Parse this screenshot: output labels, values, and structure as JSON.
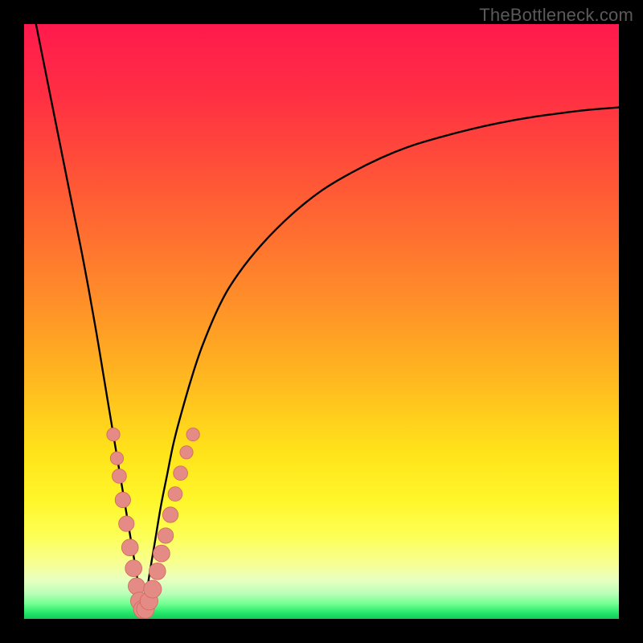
{
  "watermark": "TheBottleneck.com",
  "colors": {
    "frame": "#000000",
    "curve": "#000000",
    "marker_fill": "#e58b85",
    "marker_stroke": "#d46a63",
    "gradient_stops": [
      {
        "offset": 0.0,
        "color": "#ff1a4d"
      },
      {
        "offset": 0.12,
        "color": "#ff2f43"
      },
      {
        "offset": 0.28,
        "color": "#ff5a35"
      },
      {
        "offset": 0.45,
        "color": "#ff8a2a"
      },
      {
        "offset": 0.6,
        "color": "#ffb91f"
      },
      {
        "offset": 0.72,
        "color": "#ffe31a"
      },
      {
        "offset": 0.8,
        "color": "#fff62a"
      },
      {
        "offset": 0.86,
        "color": "#fdff55"
      },
      {
        "offset": 0.905,
        "color": "#f8ff90"
      },
      {
        "offset": 0.935,
        "color": "#e8ffc0"
      },
      {
        "offset": 0.958,
        "color": "#b8ffb8"
      },
      {
        "offset": 0.975,
        "color": "#70ff90"
      },
      {
        "offset": 0.99,
        "color": "#22e86a"
      },
      {
        "offset": 1.0,
        "color": "#16c95a"
      }
    ]
  },
  "chart_data": {
    "type": "line",
    "title": "",
    "xlabel": "",
    "ylabel": "",
    "xlim": [
      0,
      100
    ],
    "ylim": [
      0,
      100
    ],
    "note": "V-shaped bottleneck curve. y ≈ 0 (optimal) at x ≈ 20; y rises to ~100 at x→0 and asymptotically toward ~86 as x→100.",
    "series": [
      {
        "name": "bottleneck-curve",
        "x": [
          2,
          4,
          6,
          8,
          10,
          12,
          14,
          15,
          16,
          17,
          18,
          19,
          19.7,
          20.3,
          21,
          22,
          23,
          24,
          25,
          26,
          28,
          30,
          33,
          36,
          40,
          45,
          50,
          55,
          60,
          65,
          70,
          75,
          80,
          85,
          90,
          95,
          100
        ],
        "y": [
          100,
          90,
          80,
          70,
          60,
          49,
          37,
          31,
          25,
          19,
          13,
          7,
          2,
          2,
          7,
          13,
          19,
          24,
          29,
          33,
          40,
          46,
          53,
          58,
          63,
          68,
          72,
          75,
          77.5,
          79.5,
          81,
          82.3,
          83.4,
          84.3,
          85,
          85.6,
          86
        ]
      }
    ],
    "markers": {
      "name": "highlighted-points",
      "comment": "Salmon dots clustered near the curve minimum on both branches",
      "points": [
        {
          "x": 15.0,
          "y": 31,
          "r": 1.1
        },
        {
          "x": 15.6,
          "y": 27,
          "r": 1.1
        },
        {
          "x": 16.0,
          "y": 24,
          "r": 1.2
        },
        {
          "x": 16.6,
          "y": 20,
          "r": 1.3
        },
        {
          "x": 17.2,
          "y": 16,
          "r": 1.3
        },
        {
          "x": 17.8,
          "y": 12,
          "r": 1.4
        },
        {
          "x": 18.4,
          "y": 8.5,
          "r": 1.4
        },
        {
          "x": 18.9,
          "y": 5.5,
          "r": 1.4
        },
        {
          "x": 19.4,
          "y": 3.0,
          "r": 1.5
        },
        {
          "x": 19.9,
          "y": 1.6,
          "r": 1.5
        },
        {
          "x": 20.4,
          "y": 1.6,
          "r": 1.5
        },
        {
          "x": 21.0,
          "y": 3.0,
          "r": 1.5
        },
        {
          "x": 21.6,
          "y": 5.0,
          "r": 1.5
        },
        {
          "x": 22.4,
          "y": 8.0,
          "r": 1.4
        },
        {
          "x": 23.1,
          "y": 11.0,
          "r": 1.4
        },
        {
          "x": 23.8,
          "y": 14.0,
          "r": 1.3
        },
        {
          "x": 24.6,
          "y": 17.5,
          "r": 1.3
        },
        {
          "x": 25.4,
          "y": 21.0,
          "r": 1.2
        },
        {
          "x": 26.3,
          "y": 24.5,
          "r": 1.2
        },
        {
          "x": 27.3,
          "y": 28.0,
          "r": 1.1
        },
        {
          "x": 28.4,
          "y": 31.0,
          "r": 1.1
        }
      ]
    }
  }
}
